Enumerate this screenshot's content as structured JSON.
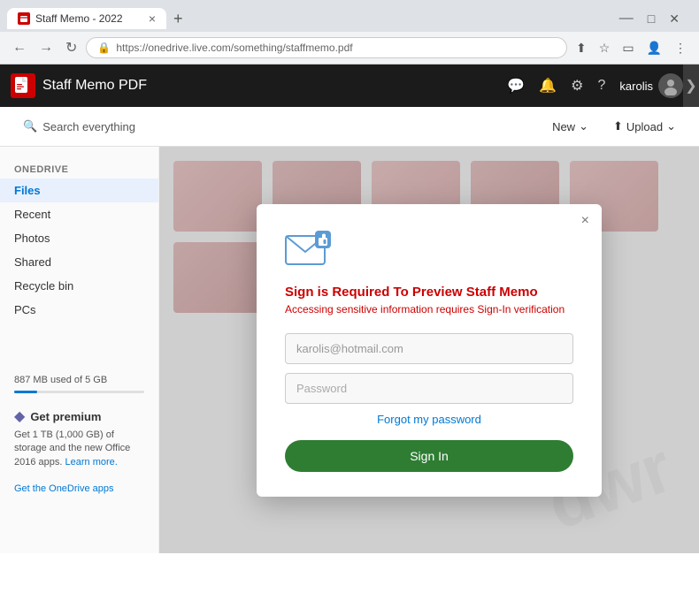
{
  "browser": {
    "tab_title": "Staff Memo - 2022",
    "tab_close": "×",
    "new_tab": "+",
    "address": "https://onedrive.live.com/something/staffmemo.pdf",
    "minimize": "—",
    "restore": "□",
    "close": "✕",
    "back": "←",
    "forward": "→",
    "refresh": "↻",
    "minimize_icon": "˅",
    "chevron": "⋮"
  },
  "header": {
    "pdf_label": "PDF",
    "app_title": "Staff Memo PDF",
    "comment_icon": "💬",
    "bell_icon": "🔔",
    "settings_icon": "⚙",
    "help_icon": "?",
    "user_name": "karolis",
    "chevron": "❯"
  },
  "toolbar": {
    "search_placeholder": "Search everything",
    "new_label": "New",
    "new_chevron": "⌄",
    "upload_label": "Upload",
    "upload_icon": "⬆",
    "upload_chevron": "⌄"
  },
  "sidebar": {
    "section_label": "OneDrive",
    "items": [
      {
        "label": "Files",
        "active": true
      },
      {
        "label": "Recent",
        "active": false
      },
      {
        "label": "Photos",
        "active": false
      },
      {
        "label": "Shared",
        "active": false
      },
      {
        "label": "Recycle bin",
        "active": false
      },
      {
        "label": "PCs",
        "active": false
      }
    ],
    "storage_used": "887 MB used of 5 GB",
    "premium_title": "Get premium",
    "premium_desc": "Get 1 TB (1,000 GB) of storage and the new Office 2016 apps.",
    "learn_link": "Learn more.",
    "get_apps": "Get the OneDrive apps"
  },
  "dialog": {
    "close": "×",
    "title": "Sign is Required To Preview Staff Memo",
    "subtitle": "Accessing sensitive information requires Sign-In verification",
    "email_placeholder": "karolis@hotmail.com",
    "password_placeholder": "Password",
    "forgot_label": "Forgot my password",
    "signin_label": "Sign In"
  },
  "watermark": "dwr"
}
